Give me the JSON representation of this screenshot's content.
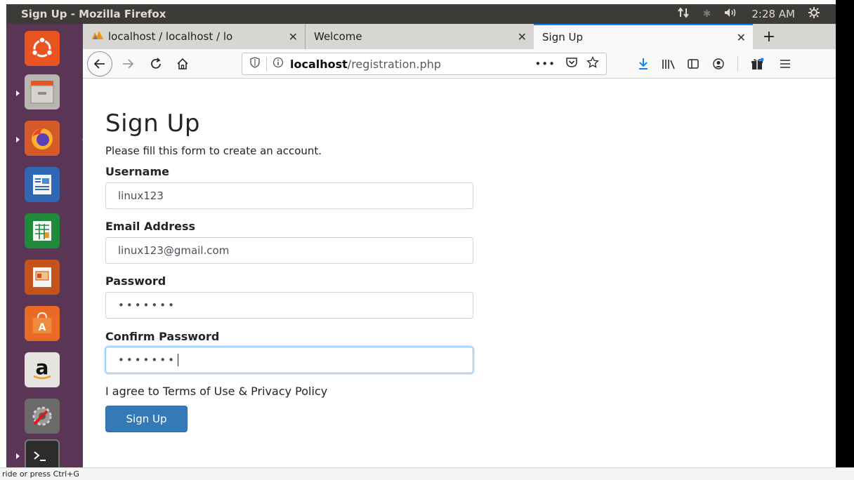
{
  "top_panel": {
    "window_title": "Sign Up - Mozilla Firefox",
    "time": "2:28 AM"
  },
  "launcher": {
    "items": [
      {
        "icon": "ubuntu-dash-icon"
      },
      {
        "icon": "files-icon"
      },
      {
        "icon": "firefox-icon"
      },
      {
        "icon": "writer-icon"
      },
      {
        "icon": "calc-icon"
      },
      {
        "icon": "impress-icon"
      },
      {
        "icon": "software-center-icon"
      },
      {
        "icon": "amazon-icon"
      },
      {
        "icon": "system-settings-icon"
      },
      {
        "icon": "terminal-icon"
      }
    ]
  },
  "browser": {
    "tabs": [
      {
        "label": "localhost / localhost / lo",
        "icon": "phpmyadmin-icon",
        "active": false
      },
      {
        "label": "Welcome",
        "active": false
      },
      {
        "label": "Sign Up",
        "active": true
      }
    ],
    "url": {
      "host": "localhost",
      "path": "/registration.php"
    }
  },
  "page": {
    "title": "Sign Up",
    "subtitle": "Please fill this form to create an account.",
    "fields": {
      "username": {
        "label": "Username",
        "value": "linux123"
      },
      "email": {
        "label": "Email Address",
        "value": "linux123@gmail.com"
      },
      "password": {
        "label": "Password",
        "value": "•••••••"
      },
      "confirm": {
        "label": "Confirm Password",
        "value": "•••••••"
      }
    },
    "agree_text": "I agree to Terms of Use & Privacy Policy",
    "submit_label": "Sign Up"
  },
  "statusbar": {
    "text": "ride or press Ctrl+G"
  },
  "colors": {
    "launcher_bg": "#5b3556",
    "panel_bg": "#3c3b37",
    "primary_button": "#337ab7",
    "tab_accent": "#0a84ff"
  }
}
